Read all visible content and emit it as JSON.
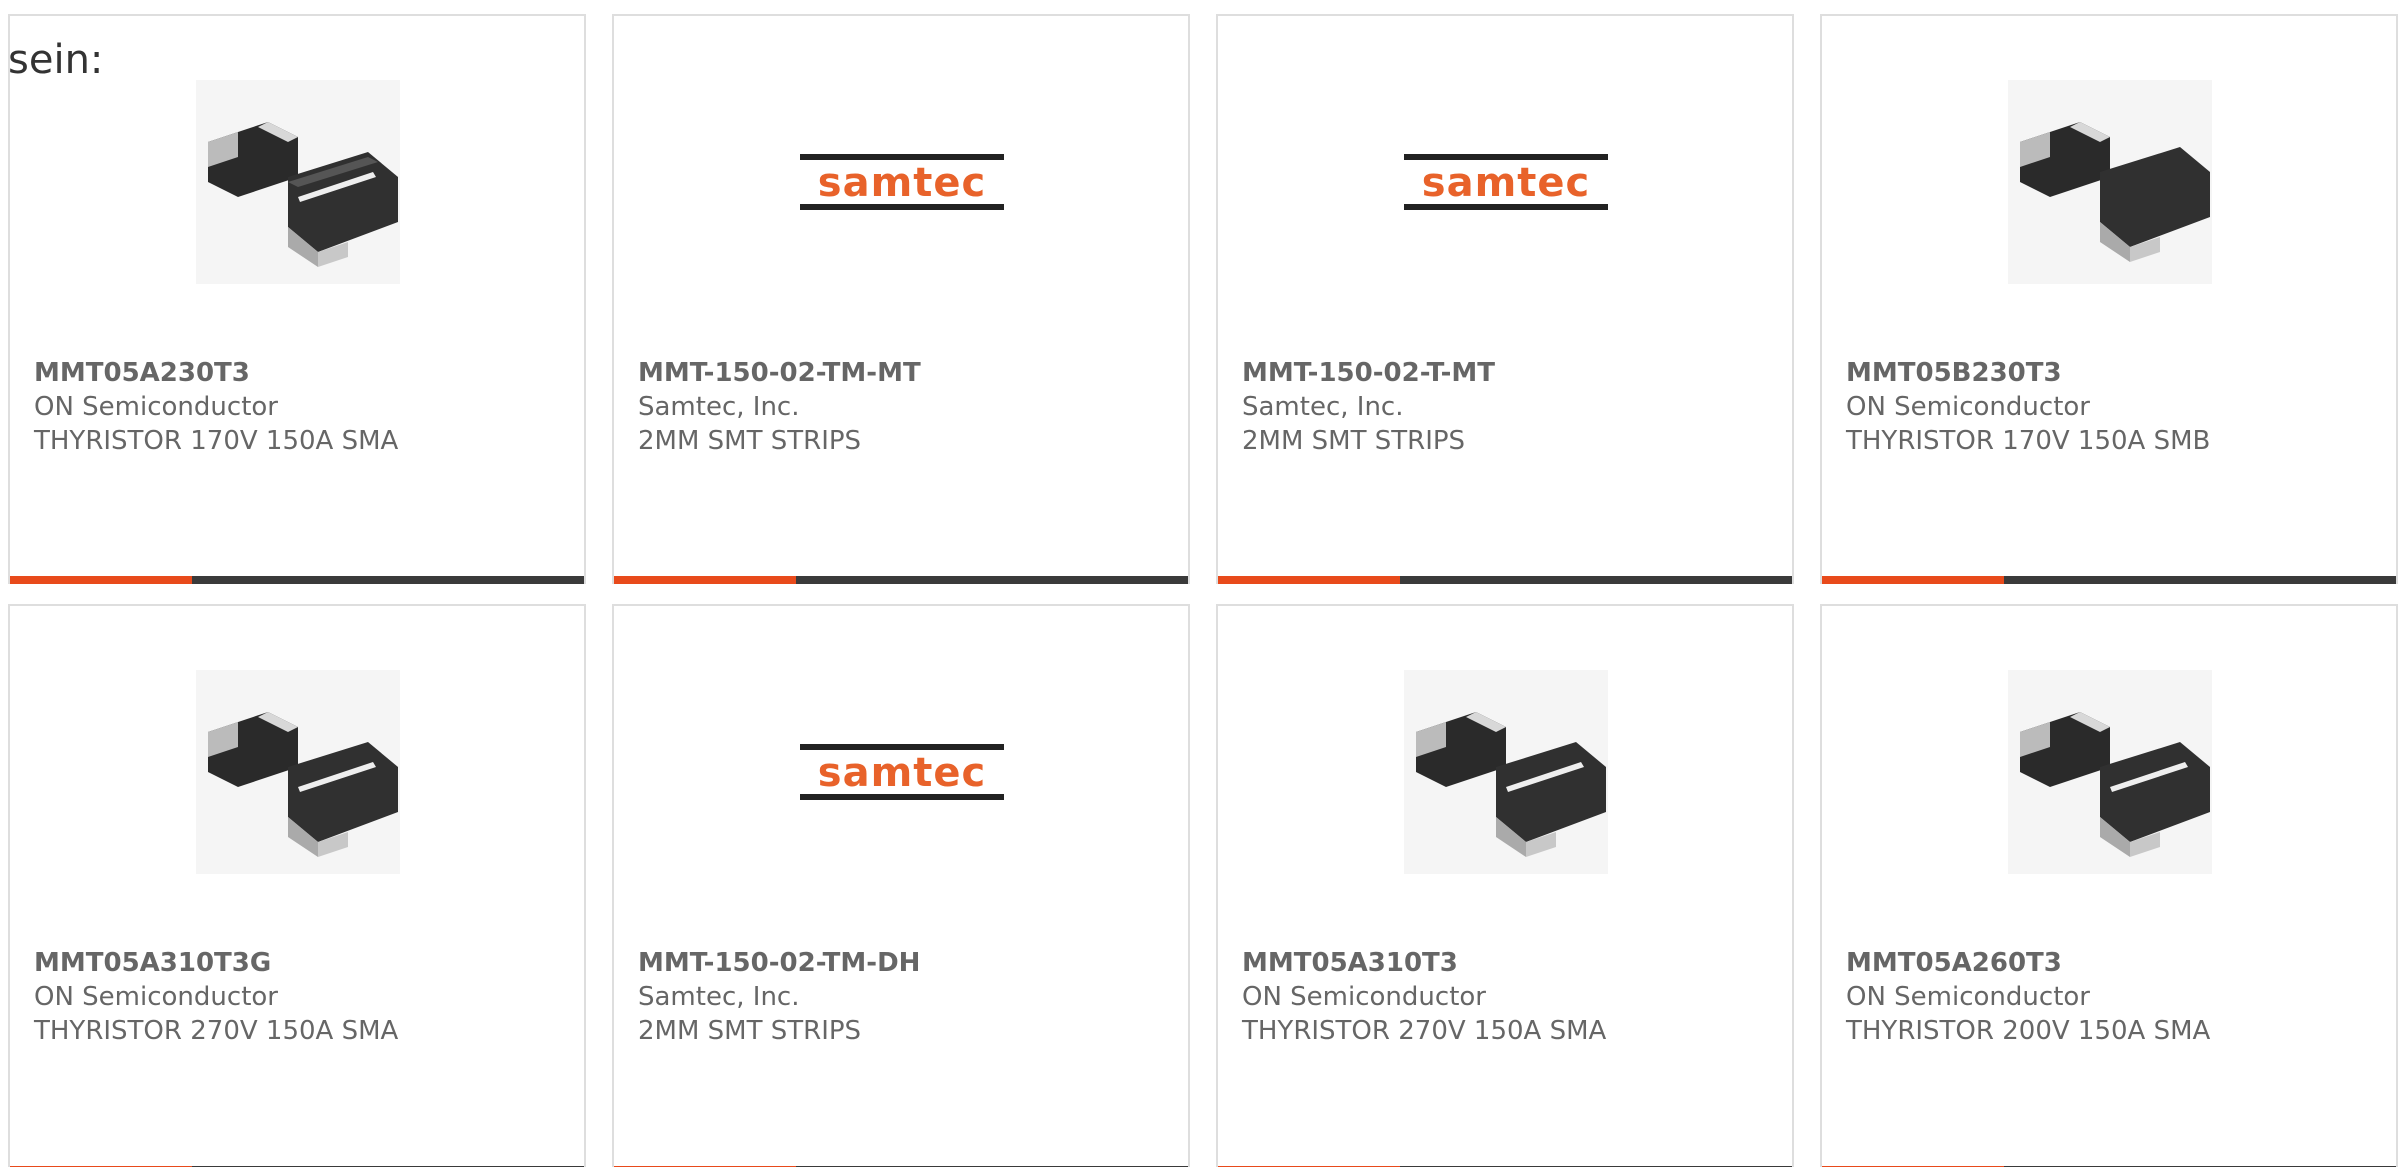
{
  "intro": {
    "text": "sein:"
  },
  "products": [
    {
      "image": "sma-diode-icon",
      "part_number": "MMT05A230T3",
      "manufacturer": "ON Semiconductor",
      "description": "THYRISTOR 170V 150A SMA"
    },
    {
      "image": "samtec-logo",
      "logo_text": "samtec",
      "part_number": "MMT-150-02-TM-MT",
      "manufacturer": "Samtec, Inc.",
      "description": "2MM SMT STRIPS"
    },
    {
      "image": "samtec-logo",
      "logo_text": "samtec",
      "part_number": "MMT-150-02-T-MT",
      "manufacturer": "Samtec, Inc.",
      "description": "2MM SMT STRIPS"
    },
    {
      "image": "smb-diode-icon",
      "part_number": "MMT05B230T3",
      "manufacturer": "ON Semiconductor",
      "description": "THYRISTOR 170V 150A SMB"
    },
    {
      "image": "sma-diode-icon",
      "part_number": "MMT05A310T3G",
      "manufacturer": "ON Semiconductor",
      "description": "THYRISTOR 270V 150A SMA"
    },
    {
      "image": "samtec-logo",
      "logo_text": "samtec",
      "part_number": "MMT-150-02-TM-DH",
      "manufacturer": "Samtec, Inc.",
      "description": "2MM SMT STRIPS"
    },
    {
      "image": "sma-diode-icon",
      "part_number": "MMT05A310T3",
      "manufacturer": "ON Semiconductor",
      "description": "THYRISTOR 270V 150A SMA"
    },
    {
      "image": "sma-diode-icon",
      "part_number": "MMT05A260T3",
      "manufacturer": "ON Semiconductor",
      "description": "THYRISTOR 200V 150A SMA"
    }
  ],
  "colors": {
    "accent": "#e84a1b",
    "bar_dark": "#3a3a3a",
    "card_border": "#dedede",
    "text": "#666666"
  }
}
